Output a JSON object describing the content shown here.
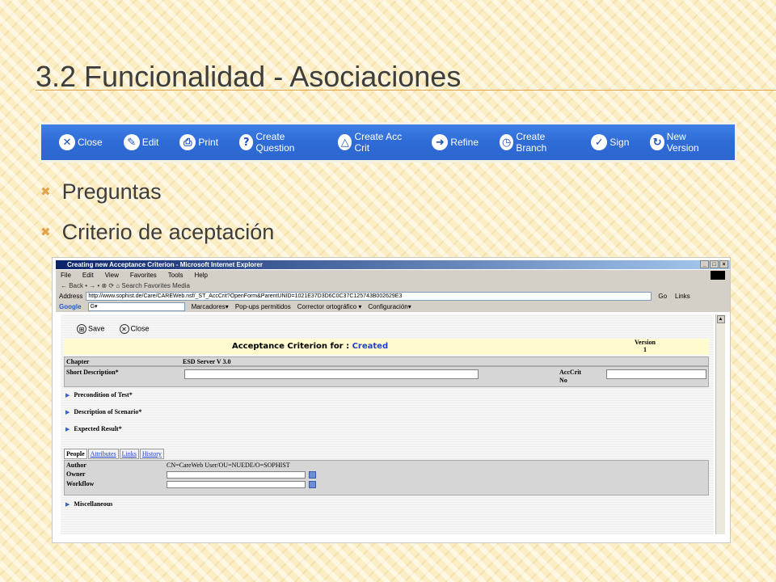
{
  "slide": {
    "title": "3.2 Funcionalidad - Asociaciones",
    "bullets": [
      "Preguntas",
      "Criterio de aceptación"
    ]
  },
  "toolbar": {
    "buttons": [
      {
        "label": "Close",
        "icon": "close-icon"
      },
      {
        "label": "Edit",
        "icon": "edit-icon"
      },
      {
        "label": "Print",
        "icon": "print-icon"
      },
      {
        "label": "Create Question",
        "icon": "question-icon"
      },
      {
        "label": "Create Acc Crit",
        "icon": "acc-crit-icon"
      },
      {
        "label": "Refine",
        "icon": "refine-icon"
      },
      {
        "label": "Create Branch",
        "icon": "branch-icon"
      },
      {
        "label": "Sign",
        "icon": "check-icon"
      },
      {
        "label": "New Version",
        "icon": "new-version-icon"
      }
    ]
  },
  "browser": {
    "window_title": "Creating new Acceptance Criterion - Microsoft Internet Explorer",
    "menu": [
      "File",
      "Edit",
      "View",
      "Favorites",
      "Tools",
      "Help"
    ],
    "std_toolbar": "← Back  •  →  •  ⊗  ⟳  ⌂   Search   Favorites   Media",
    "address_label": "Address",
    "url": "http://www.sophist.de/Care/CAREWeb.nsf/_ST_AccCrit?OpenForm&ParentUNID=1021E37D3D6C0C37C125743B002629E3",
    "go": "Go",
    "links": "Links",
    "google": {
      "logo": "Google",
      "field": "G▾",
      "items": [
        "Marcadores▾",
        "Pop-ups permitidos",
        "Corrector ortográfico ▾",
        "Configuración▾"
      ]
    }
  },
  "form": {
    "save": "Save",
    "close": "Close",
    "header_prefix": "Acceptance Criterion for : ",
    "header_status": "Created",
    "version_label": "Version",
    "version_number": "1",
    "chapter_label": "Chapter",
    "chapter_value": "ESD Server V 3.0",
    "short_desc_label": "Short Description*",
    "acccrit_label_1": "AccCrit",
    "acccrit_label_2": "No",
    "sections": [
      "Precondition of Test*",
      "Description of Scenario*",
      "Expected Result*"
    ],
    "tabs": [
      "People",
      "Attributes",
      "Links",
      "History"
    ],
    "author_label": "Author",
    "author_value": "CN=CareWeb User/OU=NUEDE/O=SOPHIST",
    "owner_label": "Owner",
    "workflow_label": "Workflow",
    "misc_label": "Miscellaneous"
  }
}
